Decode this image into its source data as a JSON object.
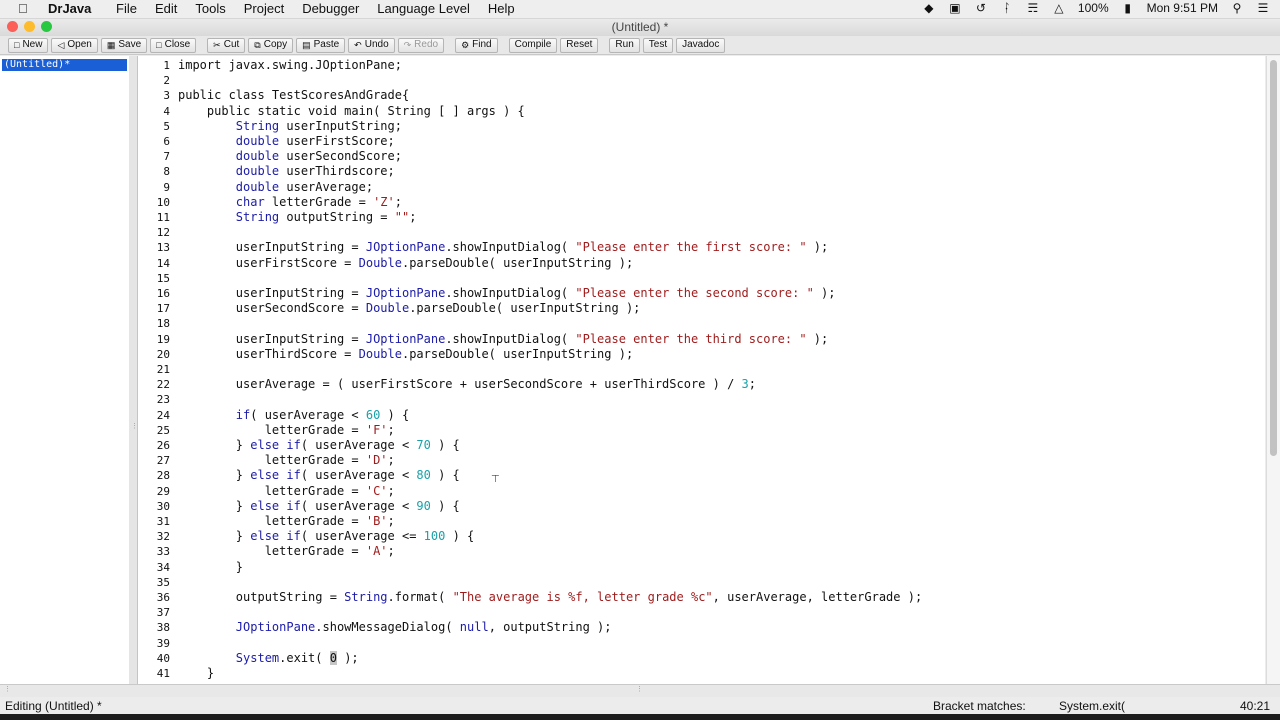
{
  "menubar": {
    "apple": "",
    "app_name": "DrJava",
    "menus": [
      "File",
      "Edit",
      "Tools",
      "Project",
      "Debugger",
      "Language Level",
      "Help"
    ],
    "battery": "100%",
    "clock": "Mon 9:51 PM"
  },
  "window": {
    "title": "(Untitled) *"
  },
  "toolbar": {
    "new": "New",
    "open": "Open",
    "save": "Save",
    "close": "Close",
    "cut": "Cut",
    "copy": "Copy",
    "paste": "Paste",
    "undo": "Undo",
    "redo": "Redo",
    "find": "Find",
    "compile": "Compile",
    "reset": "Reset",
    "run": "Run",
    "test": "Test",
    "javadoc": "Javadoc"
  },
  "sidebar": {
    "document": "(Untitled)*"
  },
  "editor": {
    "lines": [
      {
        "n": "1",
        "tokens": [
          [
            "",
            "import javax.swing.JOptionPane;"
          ]
        ]
      },
      {
        "n": "2",
        "tokens": []
      },
      {
        "n": "3",
        "tokens": [
          [
            "",
            "public class TestScoresAndGrade{"
          ]
        ]
      },
      {
        "n": "4",
        "tokens": [
          [
            "",
            "    public static void main( String [ ] args ) {"
          ]
        ]
      },
      {
        "n": "5",
        "tokens": [
          [
            "kw",
            "        String"
          ],
          [
            "",
            " userInputString;"
          ]
        ]
      },
      {
        "n": "6",
        "tokens": [
          [
            "kw",
            "        double"
          ],
          [
            "",
            " userFirstScore;"
          ]
        ]
      },
      {
        "n": "7",
        "tokens": [
          [
            "kw",
            "        double"
          ],
          [
            "",
            " userSecondScore;"
          ]
        ]
      },
      {
        "n": "8",
        "tokens": [
          [
            "kw",
            "        double"
          ],
          [
            "",
            " userThirdscore;"
          ]
        ]
      },
      {
        "n": "9",
        "tokens": [
          [
            "kw",
            "        double"
          ],
          [
            "",
            " userAverage;"
          ]
        ]
      },
      {
        "n": "10",
        "tokens": [
          [
            "kw",
            "        char"
          ],
          [
            "",
            " letterGrade = "
          ],
          [
            "st",
            "'Z'"
          ],
          [
            "",
            ";"
          ]
        ]
      },
      {
        "n": "11",
        "tokens": [
          [
            "kw",
            "        String"
          ],
          [
            "",
            " outputString = "
          ],
          [
            "st",
            "\"\""
          ],
          [
            "",
            ";"
          ]
        ]
      },
      {
        "n": "12",
        "tokens": []
      },
      {
        "n": "13",
        "tokens": [
          [
            "",
            "        userInputString = "
          ],
          [
            "kw",
            "JOptionPane"
          ],
          [
            "",
            ".showInputDialog( "
          ],
          [
            "st",
            "\"Please enter the first score: \""
          ],
          [
            "",
            " );"
          ]
        ]
      },
      {
        "n": "14",
        "tokens": [
          [
            "",
            "        userFirstScore = "
          ],
          [
            "kw",
            "Double"
          ],
          [
            "",
            ".parseDouble( userInputString );"
          ]
        ]
      },
      {
        "n": "15",
        "tokens": []
      },
      {
        "n": "16",
        "tokens": [
          [
            "",
            "        userInputString = "
          ],
          [
            "kw",
            "JOptionPane"
          ],
          [
            "",
            ".showInputDialog( "
          ],
          [
            "st",
            "\"Please enter the second score: \""
          ],
          [
            "",
            " );"
          ]
        ]
      },
      {
        "n": "17",
        "tokens": [
          [
            "",
            "        userSecondScore = "
          ],
          [
            "kw",
            "Double"
          ],
          [
            "",
            ".parseDouble( userInputString );"
          ]
        ]
      },
      {
        "n": "18",
        "tokens": []
      },
      {
        "n": "19",
        "tokens": [
          [
            "",
            "        userInputString = "
          ],
          [
            "kw",
            "JOptionPane"
          ],
          [
            "",
            ".showInputDialog( "
          ],
          [
            "st",
            "\"Please enter the third score: \""
          ],
          [
            "",
            " );"
          ]
        ]
      },
      {
        "n": "20",
        "tokens": [
          [
            "",
            "        userThirdScore = "
          ],
          [
            "kw",
            "Double"
          ],
          [
            "",
            ".parseDouble( userInputString );"
          ]
        ]
      },
      {
        "n": "21",
        "tokens": []
      },
      {
        "n": "22",
        "tokens": [
          [
            "",
            "        userAverage = ( userFirstScore + userSecondScore + userThirdScore ) / "
          ],
          [
            "nm",
            "3"
          ],
          [
            "",
            ";"
          ]
        ]
      },
      {
        "n": "23",
        "tokens": []
      },
      {
        "n": "24",
        "tokens": [
          [
            "kw",
            "        if"
          ],
          [
            "",
            "( userAverage < "
          ],
          [
            "nm",
            "60"
          ],
          [
            "",
            " ) {"
          ]
        ]
      },
      {
        "n": "25",
        "tokens": [
          [
            "",
            "            letterGrade = "
          ],
          [
            "st",
            "'F'"
          ],
          [
            "",
            ";"
          ]
        ]
      },
      {
        "n": "26",
        "tokens": [
          [
            "",
            "        } "
          ],
          [
            "kw",
            "else if"
          ],
          [
            "",
            "( userAverage < "
          ],
          [
            "nm",
            "70"
          ],
          [
            "",
            " ) {"
          ]
        ]
      },
      {
        "n": "27",
        "tokens": [
          [
            "",
            "            letterGrade = "
          ],
          [
            "st",
            "'D'"
          ],
          [
            "",
            ";"
          ]
        ]
      },
      {
        "n": "28",
        "tokens": [
          [
            "",
            "        } "
          ],
          [
            "kw",
            "else if"
          ],
          [
            "",
            "( userAverage < "
          ],
          [
            "nm",
            "80"
          ],
          [
            "",
            " ) {"
          ]
        ]
      },
      {
        "n": "29",
        "tokens": [
          [
            "",
            "            letterGrade = "
          ],
          [
            "st",
            "'C'"
          ],
          [
            "",
            ";"
          ]
        ]
      },
      {
        "n": "30",
        "tokens": [
          [
            "",
            "        } "
          ],
          [
            "kw",
            "else if"
          ],
          [
            "",
            "( userAverage < "
          ],
          [
            "nm",
            "90"
          ],
          [
            "",
            " ) {"
          ]
        ]
      },
      {
        "n": "31",
        "tokens": [
          [
            "",
            "            letterGrade = "
          ],
          [
            "st",
            "'B'"
          ],
          [
            "",
            ";"
          ]
        ]
      },
      {
        "n": "32",
        "tokens": [
          [
            "",
            "        } "
          ],
          [
            "kw",
            "else if"
          ],
          [
            "",
            "( userAverage <= "
          ],
          [
            "nm",
            "100"
          ],
          [
            "",
            " ) {"
          ]
        ]
      },
      {
        "n": "33",
        "tokens": [
          [
            "",
            "            letterGrade = "
          ],
          [
            "st",
            "'A'"
          ],
          [
            "",
            ";"
          ]
        ]
      },
      {
        "n": "34",
        "tokens": [
          [
            "",
            "        }"
          ]
        ]
      },
      {
        "n": "35",
        "tokens": []
      },
      {
        "n": "36",
        "tokens": [
          [
            "",
            "        outputString = "
          ],
          [
            "kw",
            "String"
          ],
          [
            "",
            ".format( "
          ],
          [
            "st",
            "\"The average is %f, letter grade %c\""
          ],
          [
            "",
            ", userAverage, letterGrade );"
          ]
        ]
      },
      {
        "n": "37",
        "tokens": []
      },
      {
        "n": "38",
        "tokens": [
          [
            "kw",
            "        JOptionPane"
          ],
          [
            "",
            ".showMessageDialog( "
          ],
          [
            "kw",
            "null"
          ],
          [
            "",
            ", outputString );"
          ]
        ]
      },
      {
        "n": "39",
        "tokens": []
      },
      {
        "n": "40",
        "tokens": [
          [
            "kw",
            "        System"
          ],
          [
            "",
            ".exit( "
          ],
          [
            "sel",
            "0"
          ],
          [
            "",
            " );"
          ]
        ]
      },
      {
        "n": "41",
        "tokens": [
          [
            "",
            "    }"
          ]
        ]
      }
    ]
  },
  "statusbar": {
    "mode": "Editing (Untitled) *",
    "bracket_label": "Bracket matches:",
    "bracket_value": "System.exit(",
    "position": "40:21"
  }
}
